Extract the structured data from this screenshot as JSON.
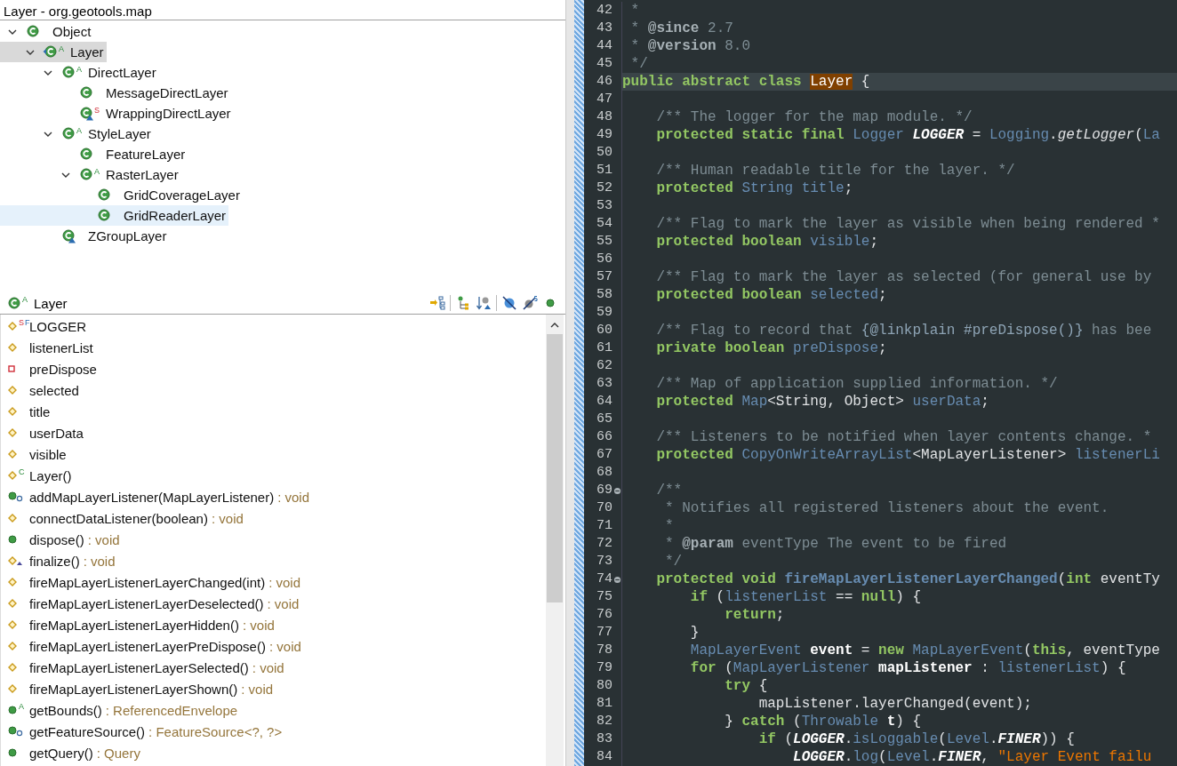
{
  "hierarchy": {
    "title": "Layer - org.geotools.map",
    "tree": [
      {
        "label": "Object",
        "kind": "plain",
        "expanded": true,
        "selected": false,
        "focused": false,
        "children": [
          {
            "label": "Layer",
            "kind": "focus",
            "badge": [
              {
                "text": "A",
                "kind": "abstract"
              }
            ],
            "expanded": true,
            "selected": false,
            "focused": true,
            "children": [
              {
                "label": "DirectLayer",
                "kind": "plain",
                "badge": [
                  {
                    "text": "A",
                    "kind": "abstract"
                  }
                ],
                "expanded": true,
                "selected": false,
                "focused": false,
                "children": [
                  {
                    "label": "MessageDirectLayer",
                    "kind": "plain",
                    "selected": false,
                    "focused": false
                  },
                  {
                    "label": "WrappingDirectLayer",
                    "kind": "triangle",
                    "badge": [
                      {
                        "text": "S",
                        "kind": "static"
                      }
                    ],
                    "selected": false,
                    "focused": false
                  }
                ]
              },
              {
                "label": "StyleLayer",
                "kind": "plain",
                "badge": [
                  {
                    "text": "A",
                    "kind": "abstract"
                  }
                ],
                "expanded": true,
                "selected": false,
                "focused": false,
                "children": [
                  {
                    "label": "FeatureLayer",
                    "kind": "plain",
                    "selected": false,
                    "focused": false
                  },
                  {
                    "label": "RasterLayer",
                    "kind": "plain",
                    "badge": [
                      {
                        "text": "A",
                        "kind": "abstract"
                      }
                    ],
                    "expanded": true,
                    "selected": false,
                    "focused": false,
                    "children": [
                      {
                        "label": "GridCoverageLayer",
                        "kind": "plain",
                        "selected": false,
                        "focused": false
                      },
                      {
                        "label": "GridReaderLayer",
                        "kind": "plain",
                        "selected": true,
                        "focused": false
                      }
                    ]
                  }
                ]
              },
              {
                "label": "ZGroupLayer",
                "kind": "triangle",
                "selected": false,
                "focused": false
              }
            ]
          }
        ]
      }
    ]
  },
  "members": {
    "header": {
      "label": "Layer",
      "badge": [
        {
          "text": "A",
          "kind": "abstract"
        }
      ]
    },
    "toolbar": [
      {
        "kind": "inherited"
      },
      {
        "kind": "separator"
      },
      {
        "kind": "hierarchy"
      },
      {
        "kind": "sort"
      },
      {
        "kind": "separator"
      },
      {
        "kind": "fields"
      },
      {
        "kind": "static"
      },
      {
        "kind": "nonpublic"
      }
    ],
    "items": [
      {
        "label": "LOGGER",
        "kind": "protected",
        "badge": [
          {
            "text": "S",
            "kind": "static"
          },
          {
            "text": "F",
            "kind": "final"
          }
        ]
      },
      {
        "label": "listenerList",
        "kind": "protected"
      },
      {
        "label": "preDispose",
        "kind": "private"
      },
      {
        "label": "selected",
        "kind": "protected"
      },
      {
        "label": "title",
        "kind": "protected"
      },
      {
        "label": "userData",
        "kind": "protected"
      },
      {
        "label": "visible",
        "kind": "protected"
      },
      {
        "label": "Layer()",
        "kind": "protected",
        "badge": [
          {
            "text": "C",
            "kind": "constructor"
          }
        ]
      },
      {
        "label": "addMapLayerListener(MapLayerListener)",
        "type": ": void",
        "kind": "implements"
      },
      {
        "label": "connectDataListener(boolean)",
        "type": ": void",
        "kind": "protected"
      },
      {
        "label": "dispose()",
        "type": ": void",
        "kind": "public"
      },
      {
        "label": "finalize()",
        "type": ": void",
        "kind": "overrides"
      },
      {
        "label": "fireMapLayerListenerLayerChanged(int)",
        "type": ": void",
        "kind": "protected"
      },
      {
        "label": "fireMapLayerListenerLayerDeselected()",
        "type": ": void",
        "kind": "protected"
      },
      {
        "label": "fireMapLayerListenerLayerHidden()",
        "type": ": void",
        "kind": "protected"
      },
      {
        "label": "fireMapLayerListenerLayerPreDispose()",
        "type": ": void",
        "kind": "protected"
      },
      {
        "label": "fireMapLayerListenerLayerSelected()",
        "type": ": void",
        "kind": "protected"
      },
      {
        "label": "fireMapLayerListenerLayerShown()",
        "type": ": void",
        "kind": "protected"
      },
      {
        "label": "getBounds()",
        "type": ": ReferencedEnvelope",
        "kind": "public",
        "badge": [
          {
            "text": "A",
            "kind": "abstract"
          }
        ]
      },
      {
        "label": "getFeatureSource()",
        "type": ": FeatureSource<?, ?>",
        "kind": "implements"
      },
      {
        "label": "getQuery()",
        "type": ": Query",
        "kind": "public"
      }
    ]
  },
  "editor": {
    "lines": [
      {
        "number": "42",
        "current": false,
        "foldable": false,
        "tokens": [
          {
            "text": " *",
            "kind": "comment"
          }
        ]
      },
      {
        "number": "43",
        "current": false,
        "foldable": false,
        "tokens": [
          {
            "text": " * ",
            "kind": "comment"
          },
          {
            "text": "@since",
            "kind": "tag"
          },
          {
            "text": " 2.7",
            "kind": "comment"
          }
        ]
      },
      {
        "number": "44",
        "current": false,
        "foldable": false,
        "tokens": [
          {
            "text": " * ",
            "kind": "comment"
          },
          {
            "text": "@version",
            "kind": "tag"
          },
          {
            "text": " 8.0",
            "kind": "comment"
          }
        ]
      },
      {
        "number": "45",
        "current": false,
        "foldable": false,
        "tokens": [
          {
            "text": " */",
            "kind": "comment"
          }
        ]
      },
      {
        "number": "46",
        "current": true,
        "foldable": false,
        "tokens": [
          {
            "text": "public abstract class ",
            "kind": "keyword"
          },
          {
            "text": "Layer",
            "kind": "match"
          },
          {
            "text": " {",
            "kind": "plain"
          }
        ]
      },
      {
        "number": "47",
        "current": false,
        "foldable": false
      },
      {
        "number": "48",
        "current": false,
        "foldable": false,
        "tokens": [
          {
            "text": "    /** The logger for the map module. */",
            "kind": "comment"
          }
        ]
      },
      {
        "number": "49",
        "current": false,
        "foldable": false,
        "tokens": [
          {
            "text": "    protected static final ",
            "kind": "keyword"
          },
          {
            "text": "Logger ",
            "kind": "type"
          },
          {
            "text": "LOGGER",
            "kind": "constant"
          },
          {
            "text": " = ",
            "kind": "plain"
          },
          {
            "text": "Logging",
            "kind": "type"
          },
          {
            "text": ".",
            "kind": "plain"
          },
          {
            "text": "getLogger",
            "kind": "call"
          },
          {
            "text": "(",
            "kind": "plain"
          },
          {
            "text": "La",
            "kind": "type"
          }
        ]
      },
      {
        "number": "50",
        "current": false,
        "foldable": false
      },
      {
        "number": "51",
        "current": false,
        "foldable": false,
        "tokens": [
          {
            "text": "    /** Human readable title for the layer. */",
            "kind": "comment"
          }
        ]
      },
      {
        "number": "52",
        "current": false,
        "foldable": false,
        "tokens": [
          {
            "text": "    protected ",
            "kind": "keyword"
          },
          {
            "text": "String title",
            "kind": "type"
          },
          {
            "text": ";",
            "kind": "plain"
          }
        ]
      },
      {
        "number": "53",
        "current": false,
        "foldable": false
      },
      {
        "number": "54",
        "current": false,
        "foldable": false,
        "tokens": [
          {
            "text": "    /** Flag to mark the layer as visible when being rendered *",
            "kind": "comment"
          }
        ]
      },
      {
        "number": "55",
        "current": false,
        "foldable": false,
        "tokens": [
          {
            "text": "    protected boolean ",
            "kind": "keyword"
          },
          {
            "text": "visible",
            "kind": "type"
          },
          {
            "text": ";",
            "kind": "plain"
          }
        ]
      },
      {
        "number": "56",
        "current": false,
        "foldable": false
      },
      {
        "number": "57",
        "current": false,
        "foldable": false,
        "tokens": [
          {
            "text": "    /** Flag to mark the layer as selected (for general use by",
            "kind": "comment"
          }
        ]
      },
      {
        "number": "58",
        "current": false,
        "foldable": false,
        "tokens": [
          {
            "text": "    protected boolean ",
            "kind": "keyword"
          },
          {
            "text": "selected",
            "kind": "type"
          },
          {
            "text": ";",
            "kind": "plain"
          }
        ]
      },
      {
        "number": "59",
        "current": false,
        "foldable": false
      },
      {
        "number": "60",
        "current": false,
        "foldable": false,
        "tokens": [
          {
            "text": "    /** Flag to record that ",
            "kind": "comment"
          },
          {
            "text": "{@linkplain #preDispose()}",
            "kind": "link"
          },
          {
            "text": " has bee",
            "kind": "comment"
          }
        ]
      },
      {
        "number": "61",
        "current": false,
        "foldable": false,
        "tokens": [
          {
            "text": "    private boolean ",
            "kind": "keyword"
          },
          {
            "text": "preDispose",
            "kind": "type"
          },
          {
            "text": ";",
            "kind": "plain"
          }
        ]
      },
      {
        "number": "62",
        "current": false,
        "foldable": false
      },
      {
        "number": "63",
        "current": false,
        "foldable": false,
        "tokens": [
          {
            "text": "    /** Map of application supplied information. */",
            "kind": "comment"
          }
        ]
      },
      {
        "number": "64",
        "current": false,
        "foldable": false,
        "tokens": [
          {
            "text": "    protected ",
            "kind": "keyword"
          },
          {
            "text": "Map",
            "kind": "type"
          },
          {
            "text": "<String, Object> ",
            "kind": "plain"
          },
          {
            "text": "userData",
            "kind": "type"
          },
          {
            "text": ";",
            "kind": "plain"
          }
        ]
      },
      {
        "number": "65",
        "current": false,
        "foldable": false
      },
      {
        "number": "66",
        "current": false,
        "foldable": false,
        "tokens": [
          {
            "text": "    /** Listeners to be notified when layer contents change. *",
            "kind": "comment"
          }
        ]
      },
      {
        "number": "67",
        "current": false,
        "foldable": false,
        "tokens": [
          {
            "text": "    protected ",
            "kind": "keyword"
          },
          {
            "text": "CopyOnWriteArrayList",
            "kind": "type"
          },
          {
            "text": "<MapLayerListener> ",
            "kind": "plain"
          },
          {
            "text": "listenerLi",
            "kind": "type"
          }
        ]
      },
      {
        "number": "68",
        "current": false,
        "foldable": false
      },
      {
        "number": "69",
        "current": false,
        "foldable": true,
        "tokens": [
          {
            "text": "    /**",
            "kind": "comment"
          }
        ]
      },
      {
        "number": "70",
        "current": false,
        "foldable": false,
        "tokens": [
          {
            "text": "     * Notifies all registered listeners about the event.",
            "kind": "comment"
          }
        ]
      },
      {
        "number": "71",
        "current": false,
        "foldable": false,
        "tokens": [
          {
            "text": "     *",
            "kind": "comment"
          }
        ]
      },
      {
        "number": "72",
        "current": false,
        "foldable": false,
        "tokens": [
          {
            "text": "     * ",
            "kind": "comment"
          },
          {
            "text": "@param",
            "kind": "tag"
          },
          {
            "text": " eventType The event to be fired",
            "kind": "comment"
          }
        ]
      },
      {
        "number": "73",
        "current": false,
        "foldable": false,
        "tokens": [
          {
            "text": "     */",
            "kind": "comment"
          }
        ]
      },
      {
        "number": "74",
        "current": false,
        "foldable": true,
        "tokens": [
          {
            "text": "    protected void ",
            "kind": "keyword"
          },
          {
            "text": "fireMapLayerListenerLayerChanged",
            "kind": "method"
          },
          {
            "text": "(",
            "kind": "plain"
          },
          {
            "text": "int",
            "kind": "keyword"
          },
          {
            "text": " eventTy",
            "kind": "plain"
          }
        ]
      },
      {
        "number": "75",
        "current": false,
        "foldable": false,
        "tokens": [
          {
            "text": "        if",
            "kind": "keyword"
          },
          {
            "text": " (",
            "kind": "plain"
          },
          {
            "text": "listenerList",
            "kind": "type"
          },
          {
            "text": " == ",
            "kind": "plain"
          },
          {
            "text": "null",
            "kind": "keyword"
          },
          {
            "text": ") {",
            "kind": "plain"
          }
        ]
      },
      {
        "number": "76",
        "current": false,
        "foldable": false,
        "tokens": [
          {
            "text": "            return",
            "kind": "keyword"
          },
          {
            "text": ";",
            "kind": "plain"
          }
        ]
      },
      {
        "number": "77",
        "current": false,
        "foldable": false,
        "tokens": [
          {
            "text": "        }",
            "kind": "plain"
          }
        ]
      },
      {
        "number": "78",
        "current": false,
        "foldable": false,
        "tokens": [
          {
            "text": "        MapLayerEvent ",
            "kind": "type"
          },
          {
            "text": "event",
            "kind": "local"
          },
          {
            "text": " = ",
            "kind": "plain"
          },
          {
            "text": "new ",
            "kind": "keyword"
          },
          {
            "text": "MapLayerEvent",
            "kind": "type"
          },
          {
            "text": "(",
            "kind": "plain"
          },
          {
            "text": "this",
            "kind": "keyword"
          },
          {
            "text": ", eventType",
            "kind": "plain"
          }
        ]
      },
      {
        "number": "79",
        "current": false,
        "foldable": false,
        "tokens": [
          {
            "text": "        for",
            "kind": "keyword"
          },
          {
            "text": " (",
            "kind": "plain"
          },
          {
            "text": "MapLayerListener ",
            "kind": "type"
          },
          {
            "text": "mapListener",
            "kind": "local"
          },
          {
            "text": " : ",
            "kind": "plain"
          },
          {
            "text": "listenerList",
            "kind": "type"
          },
          {
            "text": ") {",
            "kind": "plain"
          }
        ]
      },
      {
        "number": "80",
        "current": false,
        "foldable": false,
        "tokens": [
          {
            "text": "            try",
            "kind": "keyword"
          },
          {
            "text": " {",
            "kind": "plain"
          }
        ]
      },
      {
        "number": "81",
        "current": false,
        "foldable": false,
        "tokens": [
          {
            "text": "                mapListener.layerChanged(event);",
            "kind": "plain"
          }
        ]
      },
      {
        "number": "82",
        "current": false,
        "foldable": false,
        "tokens": [
          {
            "text": "            } ",
            "kind": "plain"
          },
          {
            "text": "catch",
            "kind": "keyword"
          },
          {
            "text": " (",
            "kind": "plain"
          },
          {
            "text": "Throwable ",
            "kind": "type"
          },
          {
            "text": "t",
            "kind": "local"
          },
          {
            "text": ") {",
            "kind": "plain"
          }
        ]
      },
      {
        "number": "83",
        "current": false,
        "foldable": false,
        "tokens": [
          {
            "text": "                if",
            "kind": "keyword"
          },
          {
            "text": " (",
            "kind": "plain"
          },
          {
            "text": "LOGGER",
            "kind": "constant"
          },
          {
            "text": ".",
            "kind": "plain"
          },
          {
            "text": "isLoggable",
            "kind": "type"
          },
          {
            "text": "(",
            "kind": "plain"
          },
          {
            "text": "Level",
            "kind": "type"
          },
          {
            "text": ".",
            "kind": "plain"
          },
          {
            "text": "FINER",
            "kind": "constant"
          },
          {
            "text": ")) {",
            "kind": "plain"
          }
        ]
      },
      {
        "number": "84",
        "current": false,
        "foldable": false,
        "tokens": [
          {
            "text": "                    LOGGER",
            "kind": "constant"
          },
          {
            "text": ".",
            "kind": "plain"
          },
          {
            "text": "log",
            "kind": "type"
          },
          {
            "text": "(",
            "kind": "plain"
          },
          {
            "text": "Level",
            "kind": "type"
          },
          {
            "text": ".",
            "kind": "plain"
          },
          {
            "text": "FINER",
            "kind": "constant"
          },
          {
            "text": ", ",
            "kind": "plain"
          },
          {
            "text": "\"Layer Event failu",
            "kind": "string"
          }
        ]
      }
    ]
  }
}
